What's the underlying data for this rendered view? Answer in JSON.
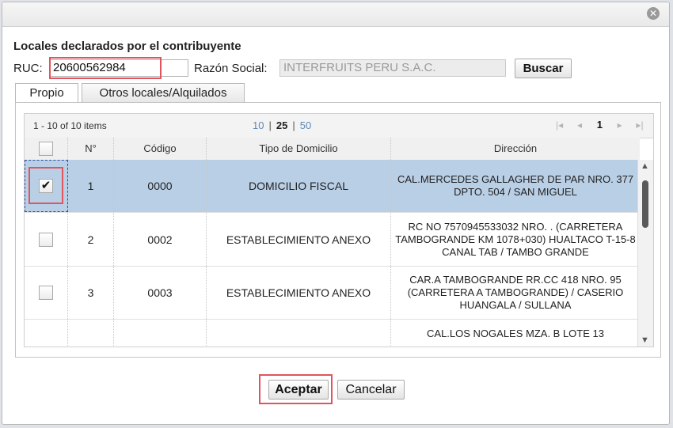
{
  "dialog": {
    "close_glyph": "✕"
  },
  "form": {
    "heading": "Locales declarados por el contribuyente",
    "ruc_label": "RUC:",
    "ruc_value": "20600562984",
    "razon_label": "Razón Social:",
    "razon_value": "INTERFRUITS PERU S.A.C.",
    "search_button": "Buscar"
  },
  "tabs": [
    {
      "label": "Propio",
      "active": true
    },
    {
      "label": "Otros locales/Alquilados",
      "active": false
    }
  ],
  "pager": {
    "count_text": "1 - 10 of 10 items",
    "sizes": [
      "10",
      "25",
      "50"
    ],
    "current_size": "25",
    "current_page": "1",
    "nav_glyphs": {
      "first": "|◂",
      "prev": "◂",
      "next": "▸",
      "last": "▸|"
    }
  },
  "table": {
    "columns": [
      "N°",
      "Código",
      "Tipo de Domicilio",
      "Dirección"
    ],
    "rows": [
      {
        "checked": true,
        "n": "1",
        "codigo": "0000",
        "tipo": "DOMICILIO FISCAL",
        "direccion": "CAL.MERCEDES GALLAGHER DE PAR NRO. 377 DPTO. 504 / SAN MIGUEL"
      },
      {
        "checked": false,
        "n": "2",
        "codigo": "0002",
        "tipo": "ESTABLECIMIENTO ANEXO",
        "direccion": "RC NO 7570945533032 NRO. . (CARRETERA TAMBOGRANDE KM 1078+030) HUALTACO T-15-8 CANAL TAB / TAMBO GRANDE"
      },
      {
        "checked": false,
        "n": "3",
        "codigo": "0003",
        "tipo": "ESTABLECIMIENTO ANEXO",
        "direccion": "CAR.A TAMBOGRANDE RR.CC 418 NRO. 95 (CARRETERA A TAMBOGRANDE) / CASERIO HUANGALA / SULLANA"
      },
      {
        "checked": false,
        "n": "",
        "codigo": "",
        "tipo": "",
        "direccion": "CAL.LOS NOGALES MZA. B LOTE 13"
      }
    ]
  },
  "footer": {
    "accept_button": "Aceptar",
    "cancel_button": "Cancelar"
  },
  "scrollbar": {
    "up_glyph": "▲",
    "down_glyph": "▼"
  },
  "check_glyph": "✔",
  "colors": {
    "selected_row": "#b9cfe6",
    "highlight": "#e0555d",
    "link": "#5f88b5"
  }
}
